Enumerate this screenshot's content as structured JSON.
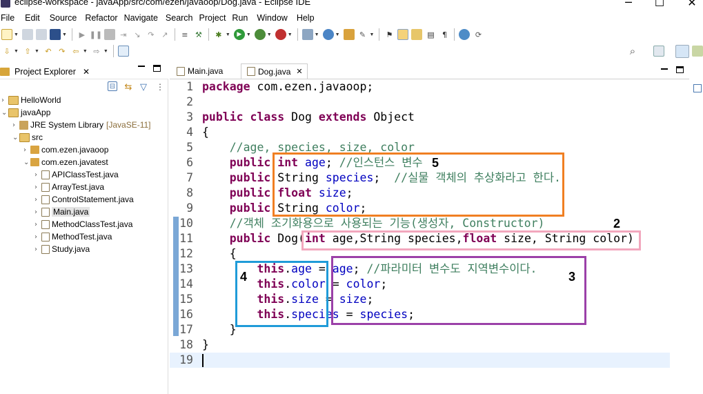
{
  "window": {
    "title": "eclipse-workspace - javaApp/src/com/ezen/javaoop/Dog.java - Eclipse IDE"
  },
  "menu": [
    "File",
    "Edit",
    "Source",
    "Refactor",
    "Navigate",
    "Search",
    "Project",
    "Run",
    "Window",
    "Help"
  ],
  "project_explorer": {
    "title": "Project Explorer",
    "items": [
      {
        "label": "HelloWorld",
        "suffix": ""
      },
      {
        "label": "javaApp",
        "suffix": ""
      },
      {
        "label": "JRE System Library",
        "suffix": "[JavaSE-11]"
      },
      {
        "label": "src",
        "suffix": ""
      },
      {
        "label": "com.ezen.javaoop",
        "suffix": ""
      },
      {
        "label": "com.ezen.javatest",
        "suffix": ""
      },
      {
        "label": "APIClassTest.java",
        "suffix": ""
      },
      {
        "label": "ArrayTest.java",
        "suffix": ""
      },
      {
        "label": "ControlStatement.java",
        "suffix": ""
      },
      {
        "label": "Main.java",
        "suffix": ""
      },
      {
        "label": "MethodClassTest.java",
        "suffix": ""
      },
      {
        "label": "MethodTest.java",
        "suffix": ""
      },
      {
        "label": "Study.java",
        "suffix": ""
      }
    ]
  },
  "editor": {
    "tabs": [
      {
        "label": "Main.java",
        "active": false
      },
      {
        "label": "Dog.java",
        "active": true
      }
    ],
    "code_lines": [
      "package com.ezen.javaoop;",
      "",
      "public class Dog extends Object",
      "{",
      "    //age, species, size, color",
      "    public int age; //인스턴스 변수",
      "    public String species;  //실물 객체의 추상화라고 한다.",
      "    public float size;",
      "    public String color;",
      "    //객체 조기화용으로 사용되는 기능(생성자, Constructor)",
      "    public Dog(int age,String species,float size, String color)",
      "    {",
      "        this.age = age; //파라미터 변수도 지역변수이다.",
      "        this.color = color;",
      "        this.size = size;",
      "        this.species = species;",
      "    }",
      "}",
      ""
    ],
    "current_line": 19
  },
  "annotations": [
    {
      "label": "5",
      "color": "#f07f22"
    },
    {
      "label": "2",
      "color": "#f2a7bd"
    },
    {
      "label": "3",
      "color": "#9b40a8"
    },
    {
      "label": "4",
      "color": "#1f9bd8"
    }
  ]
}
